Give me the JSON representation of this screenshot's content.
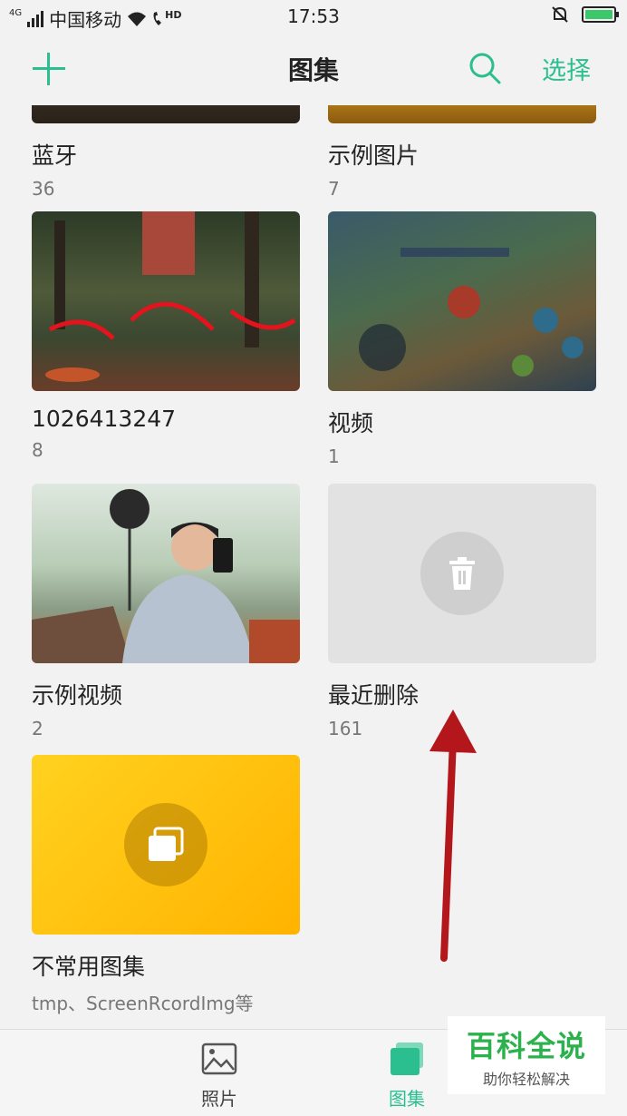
{
  "status_bar": {
    "network": "4G",
    "carrier": "中国移动",
    "hd_label": "HD",
    "time": "17:53"
  },
  "header": {
    "title": "图集",
    "select_label": "选择"
  },
  "albums": [
    {
      "name": "蓝牙",
      "count": "36"
    },
    {
      "name": "示例图片",
      "count": "7"
    },
    {
      "name": "1026413247",
      "count": "8"
    },
    {
      "name": "视频",
      "count": "1"
    },
    {
      "name": "示例视频",
      "count": "2"
    },
    {
      "name": "最近删除",
      "count": "161"
    },
    {
      "name": "不常用图集",
      "count": "tmp、ScreenRcordImg等"
    }
  ],
  "bottom_nav": [
    {
      "label": "照片",
      "icon": "photo-icon",
      "active": false
    },
    {
      "label": "图集",
      "icon": "albums-icon",
      "active": true
    }
  ],
  "watermark": {
    "title": "百科全说",
    "subtitle": "助你轻松解决"
  },
  "colors": {
    "accent": "#2bbf8f",
    "text": "#222222",
    "subtext": "#777777",
    "annotation_arrow": "#b3161b"
  }
}
